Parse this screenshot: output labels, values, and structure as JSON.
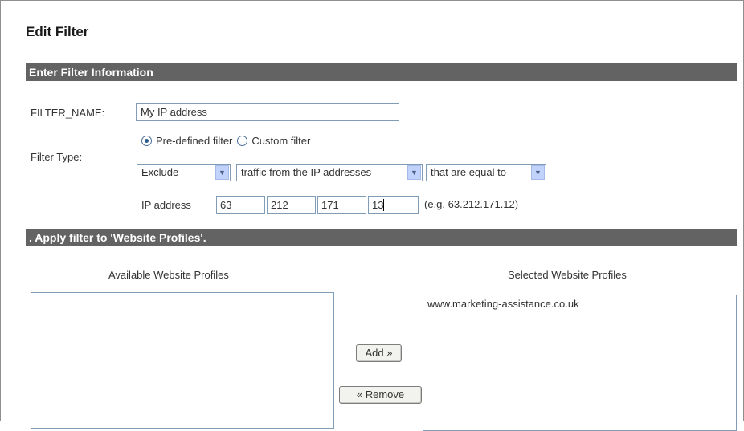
{
  "page": {
    "title": "Edit Filter"
  },
  "section1": {
    "title": "Enter Filter Information"
  },
  "form": {
    "filter_name_label": "FILTER_NAME:",
    "filter_name_value": "My IP address",
    "filter_type_label": "Filter Type:",
    "radio_predefined": "Pre-defined filter",
    "radio_custom": "Custom filter",
    "radio_selected": "predefined",
    "select_action": "Exclude",
    "select_source": "traffic from the IP addresses",
    "select_condition": "that are equal to",
    "ip_label": "IP address",
    "ip_octets": [
      "63",
      "212",
      "171",
      "13"
    ],
    "ip_hint": "(e.g. 63.212.171.12)"
  },
  "section2": {
    "title": ". Apply filter to 'Website Profiles'."
  },
  "profiles": {
    "available_label": "Available Website Profiles",
    "selected_label": "Selected Website Profiles",
    "available_items": [],
    "selected_items": [
      "www.marketing-assistance.co.uk"
    ],
    "add_button": "Add »",
    "remove_button": "« Remove"
  },
  "icons": {
    "dropdown": "chevron-down-icon",
    "radio_on": "radio-selected-icon",
    "radio_off": "radio-unselected-icon"
  },
  "colors": {
    "section_bar": "#636363",
    "input_border": "#7f9db9",
    "dropdown_button": "#c1d3fb"
  }
}
